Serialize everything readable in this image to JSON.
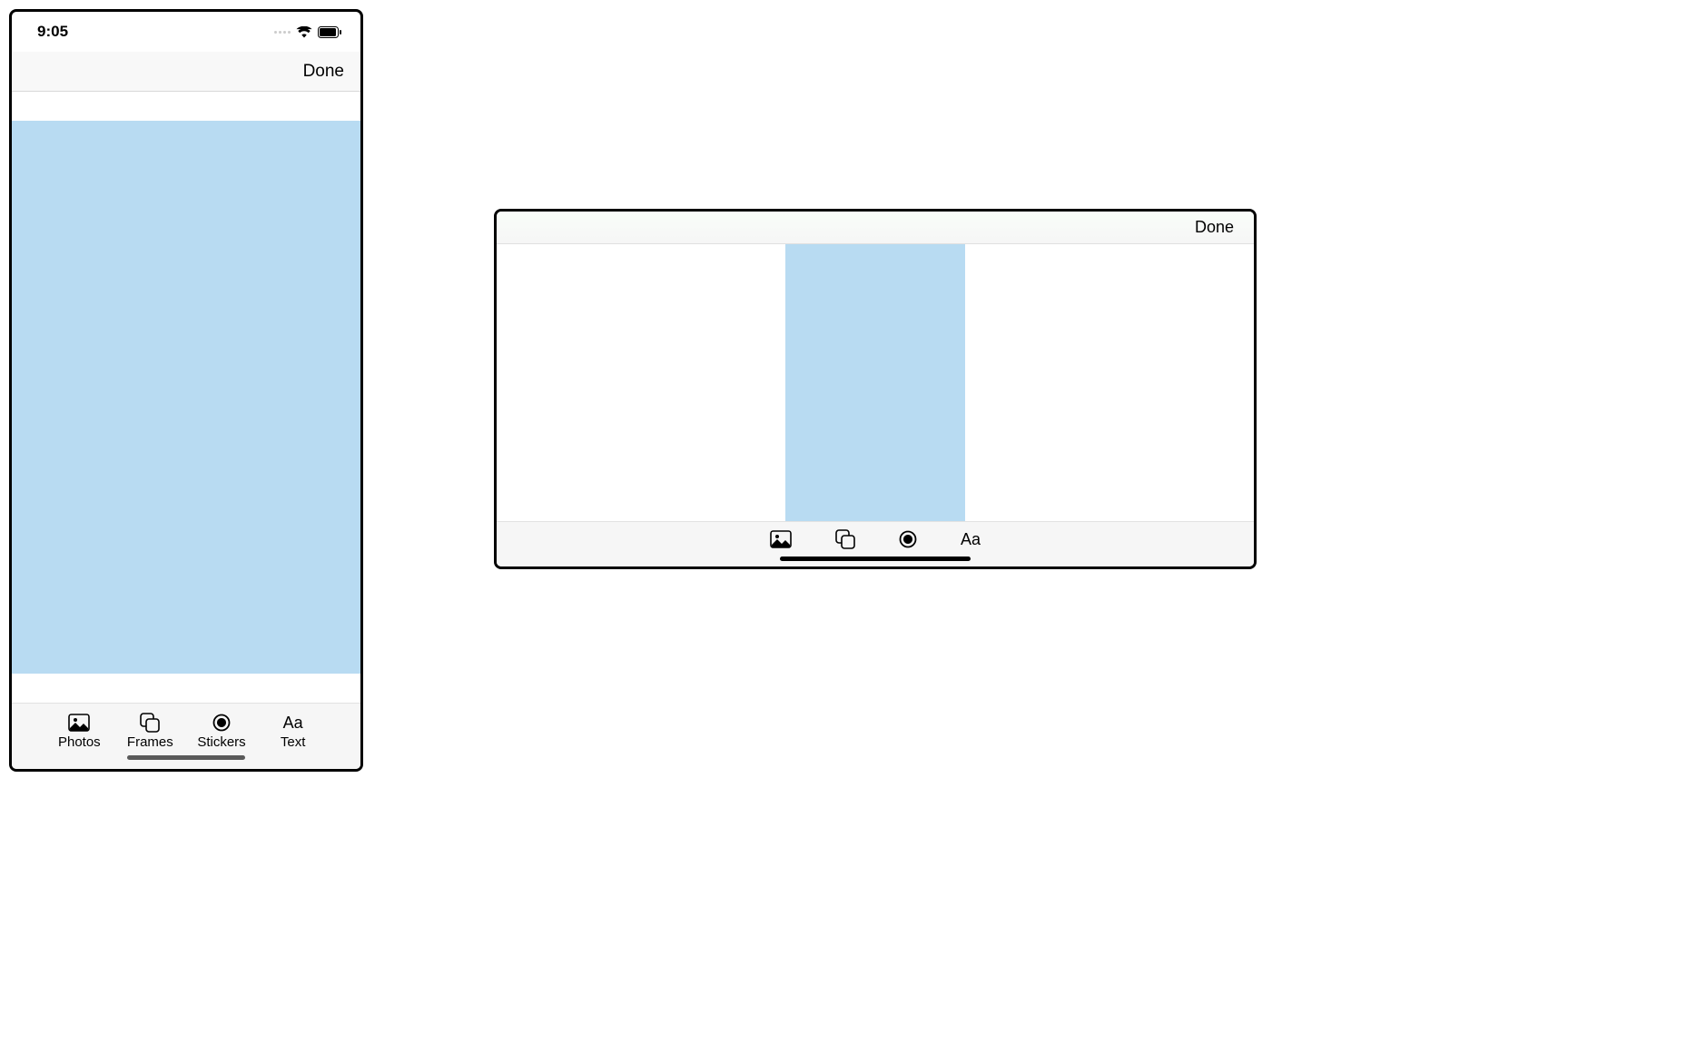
{
  "status": {
    "time": "9:05"
  },
  "nav": {
    "done_label": "Done"
  },
  "toolbar": {
    "items": [
      {
        "label": "Photos",
        "icon": "photo-icon"
      },
      {
        "label": "Frames",
        "icon": "frames-icon"
      },
      {
        "label": "Stickers",
        "icon": "stickers-icon"
      },
      {
        "label": "Text",
        "icon": "text-icon",
        "glyph": "Aa"
      }
    ]
  },
  "canvas": {
    "color": "#b8dbf2"
  }
}
